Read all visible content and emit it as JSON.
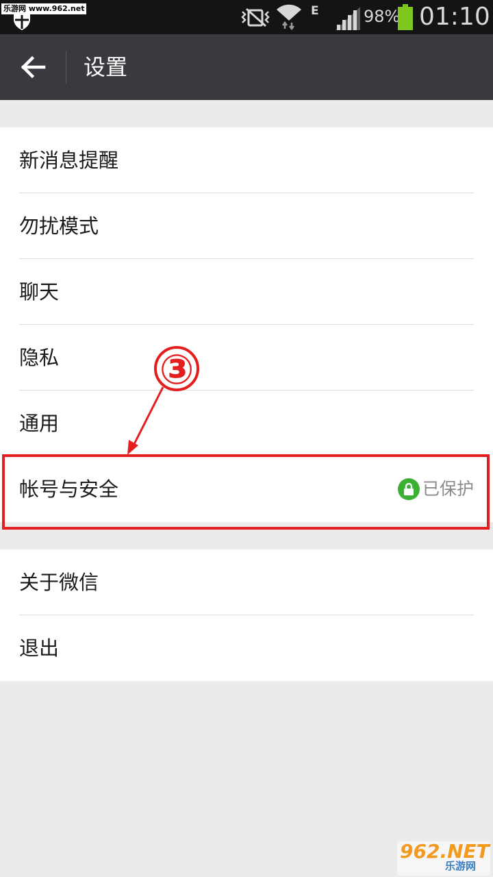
{
  "status_bar": {
    "watermark": "乐游网 www.962.net",
    "network_type": "E",
    "battery_percent": "98%",
    "time": "01:10",
    "icons": [
      "shield-icon",
      "no-vibrate-icon",
      "wifi-icon",
      "signal-icon",
      "battery-icon"
    ]
  },
  "action_bar": {
    "back_icon": "back-arrow-icon",
    "title": "设置"
  },
  "settings": {
    "group1": [
      {
        "label": "新消息提醒"
      },
      {
        "label": "勿扰模式"
      },
      {
        "label": "聊天"
      },
      {
        "label": "隐私"
      },
      {
        "label": "通用"
      },
      {
        "label": "帐号与安全",
        "status": "已保护",
        "status_icon": "lock-icon"
      }
    ],
    "group2": [
      {
        "label": "关于微信"
      },
      {
        "label": "退出"
      }
    ]
  },
  "annotation": {
    "step": "③",
    "color": "#e41e1e"
  },
  "watermark_bottom": {
    "logo": "962.NET",
    "sub": "乐游网"
  },
  "colors": {
    "action_bar": "#393a3f",
    "background": "#ebebeb",
    "lock_badge": "#3cb034",
    "battery": "#7ec620"
  }
}
